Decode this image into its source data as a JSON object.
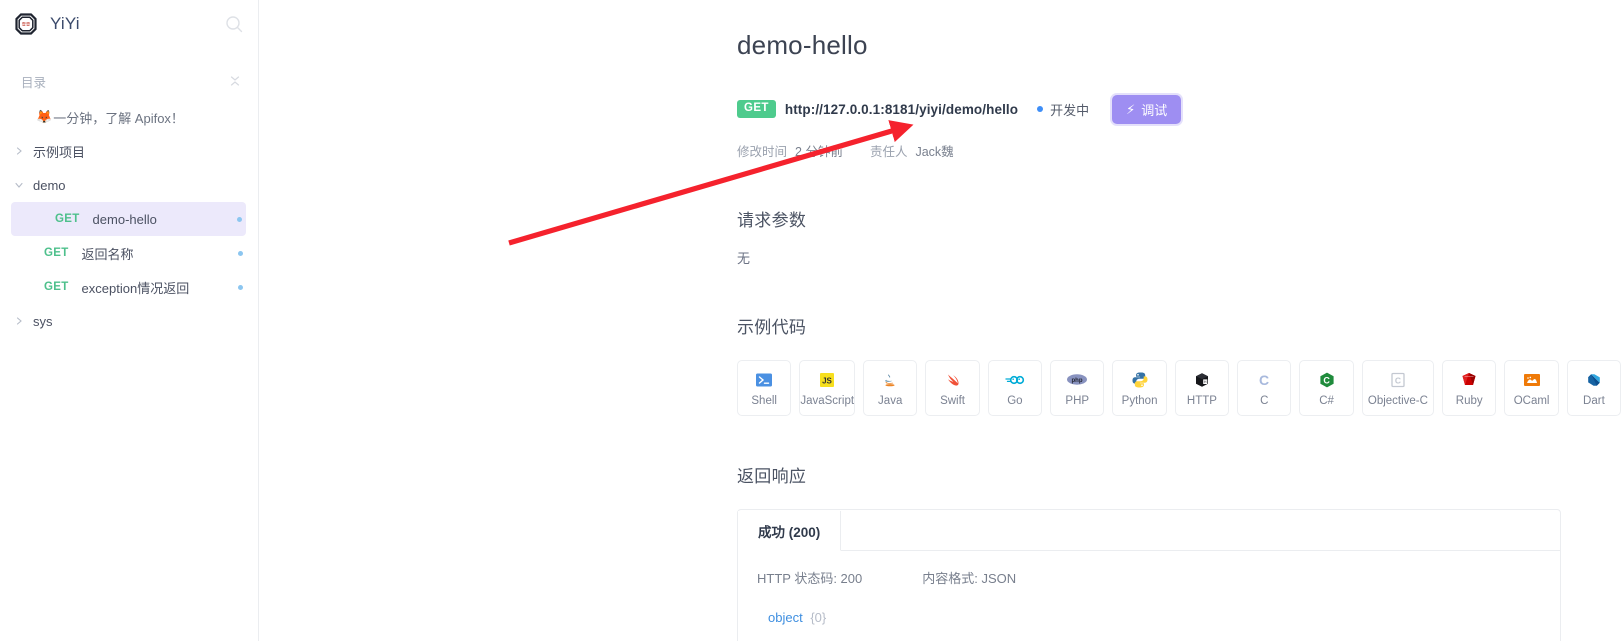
{
  "sidebar": {
    "brand": "YiYi",
    "search_icon": "search-icon",
    "section": {
      "label": "目录",
      "collapse_icon": "collapse-icon"
    },
    "items": [
      {
        "type": "promo",
        "emoji": "🦊",
        "label": "一分钟，了解 Apifox！"
      },
      {
        "type": "folder",
        "label": "示例项目",
        "caret": "chevron-right-icon"
      },
      {
        "type": "folder",
        "label": "demo",
        "caret": "chevron-down-icon"
      },
      {
        "type": "api",
        "method": "GET",
        "label": "demo-hello",
        "active": true
      },
      {
        "type": "api",
        "method": "GET",
        "label": "返回名称",
        "active": false
      },
      {
        "type": "api",
        "method": "GET",
        "label": "exception情况返回",
        "active": false
      },
      {
        "type": "folder",
        "label": "sys",
        "caret": "chevron-right-icon"
      }
    ]
  },
  "main": {
    "title": "demo-hello",
    "method": "GET",
    "url": "http://127.0.0.1:8181/yiyi/demo/hello",
    "status": "开发中",
    "debug_button": {
      "label": "调试",
      "icon": "lightning-icon"
    },
    "meta": {
      "modified_key": "修改时间",
      "modified_value": "2 分钟前",
      "owner_key": "责任人",
      "owner_value": "Jack魏"
    },
    "request_params": {
      "title": "请求参数",
      "empty": "无"
    },
    "sample_code": {
      "title": "示例代码",
      "languages": [
        {
          "label": "Shell",
          "icon": "shell-icon"
        },
        {
          "label": "JavaScript",
          "icon": "javascript-icon"
        },
        {
          "label": "Java",
          "icon": "java-icon"
        },
        {
          "label": "Swift",
          "icon": "swift-icon"
        },
        {
          "label": "Go",
          "icon": "go-icon"
        },
        {
          "label": "PHP",
          "icon": "php-icon"
        },
        {
          "label": "Python",
          "icon": "python-icon"
        },
        {
          "label": "HTTP",
          "icon": "http-icon"
        },
        {
          "label": "C",
          "icon": "c-icon"
        },
        {
          "label": "C#",
          "icon": "csharp-icon"
        },
        {
          "label": "Objective-C",
          "icon": "objective-c-icon"
        },
        {
          "label": "Ruby",
          "icon": "ruby-icon"
        },
        {
          "label": "OCaml",
          "icon": "ocaml-icon"
        },
        {
          "label": "Dart",
          "icon": "dart-icon"
        }
      ]
    },
    "response": {
      "title": "返回响应",
      "tab": "成功 (200)",
      "status_code": "HTTP 状态码: 200",
      "content_type": "内容格式: JSON",
      "schema_name": "object",
      "schema_count": "{0}"
    }
  },
  "colors": {
    "accent_purple": "#9e8ef2",
    "method_green": "#4ecb8d",
    "status_blue": "#3e8ef7",
    "active_row": "#ece9fb",
    "arrow_red": "#f5222d"
  }
}
